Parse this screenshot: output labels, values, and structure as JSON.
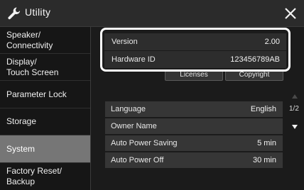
{
  "titlebar": {
    "title": "Utility",
    "icon": "wrench-icon",
    "close_icon": "close-icon"
  },
  "sidebar": {
    "items": [
      {
        "label_line1": "Speaker/",
        "label_line2": "Connectivity"
      },
      {
        "label_line1": "Display/",
        "label_line2": "Touch Screen"
      },
      {
        "label_line1": "Parameter Lock",
        "label_line2": ""
      },
      {
        "label_line1": "Storage",
        "label_line2": ""
      },
      {
        "label_line1": "System",
        "label_line2": "",
        "selected": true
      },
      {
        "label_line1": "Factory Reset/",
        "label_line2": "Backup"
      }
    ]
  },
  "info": {
    "version_label": "Version",
    "version_value": "2.00",
    "hardware_label": "Hardware ID",
    "hardware_value": "123456789AB"
  },
  "buttons": {
    "licenses": "Licenses",
    "copyright": "Copyright"
  },
  "settings": [
    {
      "label": "Language",
      "value": "English"
    },
    {
      "label": "Owner Name",
      "value": ""
    },
    {
      "label": "Auto Power Saving",
      "value": "5 min"
    },
    {
      "label": "Auto Power Off",
      "value": "30 min"
    }
  ],
  "pager": {
    "page_indicator": "1/2"
  },
  "colors": {
    "highlight": "#ffffff",
    "selected_tab": "#767676"
  }
}
